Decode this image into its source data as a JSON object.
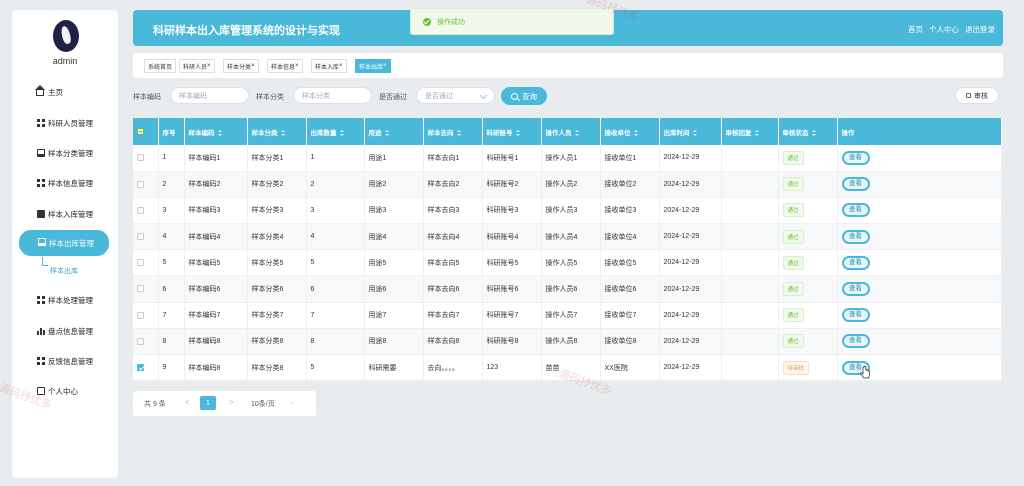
{
  "app": {
    "title": "科研样本出入库管理系统的设计与实现",
    "user": "admin"
  },
  "header_links": [
    "首页",
    "个人中心",
    "退出登录"
  ],
  "toast": "操作成功",
  "sidebar": {
    "items": [
      {
        "label": "主页",
        "icon": "home-icon"
      },
      {
        "label": "科研人员管理",
        "icon": "grid-icon"
      },
      {
        "label": "样本分类管理",
        "icon": "monitor-icon"
      },
      {
        "label": "样本信息管理",
        "icon": "grid-icon"
      },
      {
        "label": "样本入库管理",
        "icon": "film-icon"
      },
      {
        "label": "样本出库管理",
        "icon": "monitor-icon"
      },
      {
        "label": "样本处理管理",
        "icon": "grid-icon"
      },
      {
        "label": "盘点信息管理",
        "icon": "bar-chart-icon"
      },
      {
        "label": "反馈信息管理",
        "icon": "grid-icon"
      },
      {
        "label": "个人中心",
        "icon": "user-card-icon"
      }
    ],
    "active": "样本出库管理",
    "sub_item": "样本出库"
  },
  "tabs": [
    "系统首页",
    "科研人员",
    "样本分类",
    "样本信息",
    "样本入库",
    "样本出库"
  ],
  "tab_close": "×",
  "search": {
    "code_label": "样本编码",
    "code_placeholder": "样本编码",
    "category_label": "样本分类",
    "category_placeholder": "样本分类",
    "pass_label": "是否通过",
    "pass_placeholder": "是否通过",
    "query_label": "查询",
    "audit_label": "审核"
  },
  "table": {
    "columns": [
      "序号",
      "样本编码",
      "样本分类",
      "出库数量",
      "用途",
      "样本去向",
      "科研账号",
      "操作人员",
      "接收单位",
      "出库时间",
      "审核回复",
      "审核状态",
      "操作"
    ],
    "rows": [
      {
        "idx": "1",
        "code": "样本编码1",
        "cat": "样本分类1",
        "qty": "1",
        "use": "用途1",
        "dest": "样本去向1",
        "acct": "科研账号1",
        "op": "操作人员1",
        "recv": "接收单位1",
        "time": "2024-12-29",
        "reply": "",
        "status": "通过",
        "status_type": "pass",
        "action": "查看",
        "checked": false
      },
      {
        "idx": "2",
        "code": "样本编码2",
        "cat": "样本分类2",
        "qty": "2",
        "use": "用途2",
        "dest": "样本去向2",
        "acct": "科研账号2",
        "op": "操作人员2",
        "recv": "接收单位2",
        "time": "2024-12-29",
        "reply": "",
        "status": "通过",
        "status_type": "pass",
        "action": "查看",
        "checked": false
      },
      {
        "idx": "3",
        "code": "样本编码3",
        "cat": "样本分类3",
        "qty": "3",
        "use": "用途3",
        "dest": "样本去向3",
        "acct": "科研账号3",
        "op": "操作人员3",
        "recv": "接收单位3",
        "time": "2024-12-29",
        "reply": "",
        "status": "通过",
        "status_type": "pass",
        "action": "查看",
        "checked": false
      },
      {
        "idx": "4",
        "code": "样本编码4",
        "cat": "样本分类4",
        "qty": "4",
        "use": "用途4",
        "dest": "样本去向4",
        "acct": "科研账号4",
        "op": "操作人员4",
        "recv": "接收单位4",
        "time": "2024-12-29",
        "reply": "",
        "status": "通过",
        "status_type": "pass",
        "action": "查看",
        "checked": false
      },
      {
        "idx": "5",
        "code": "样本编码5",
        "cat": "样本分类5",
        "qty": "5",
        "use": "用途5",
        "dest": "样本去向5",
        "acct": "科研账号5",
        "op": "操作人员5",
        "recv": "接收单位5",
        "time": "2024-12-29",
        "reply": "",
        "status": "通过",
        "status_type": "pass",
        "action": "查看",
        "checked": false
      },
      {
        "idx": "6",
        "code": "样本编码6",
        "cat": "样本分类6",
        "qty": "6",
        "use": "用途6",
        "dest": "样本去向6",
        "acct": "科研账号6",
        "op": "操作人员6",
        "recv": "接收单位6",
        "time": "2024-12-29",
        "reply": "",
        "status": "通过",
        "status_type": "pass",
        "action": "查看",
        "checked": false
      },
      {
        "idx": "7",
        "code": "样本编码7",
        "cat": "样本分类7",
        "qty": "7",
        "use": "用途7",
        "dest": "样本去向7",
        "acct": "科研账号7",
        "op": "操作人员7",
        "recv": "接收单位7",
        "time": "2024-12-29",
        "reply": "",
        "status": "通过",
        "status_type": "pass",
        "action": "查看",
        "checked": false
      },
      {
        "idx": "8",
        "code": "样本编码8",
        "cat": "样本分类8",
        "qty": "8",
        "use": "用途8",
        "dest": "样本去向8",
        "acct": "科研账号8",
        "op": "操作人员8",
        "recv": "接收单位8",
        "time": "2024-12-29",
        "reply": "",
        "status": "通过",
        "status_type": "pass",
        "action": "查看",
        "checked": false
      },
      {
        "idx": "9",
        "code": "样本编码8",
        "cat": "样本分类8",
        "qty": "5",
        "use": "科研需要",
        "dest": "去向。。。。",
        "acct": "123",
        "op": "苗苗",
        "recv": "XX医院",
        "time": "2024-12-29",
        "reply": "",
        "status": "待审核",
        "status_type": "pending",
        "action": "查看",
        "checked": true
      }
    ]
  },
  "pager": {
    "total": "共 9 条",
    "prev": "<",
    "current": "1",
    "next": ">",
    "page_size": "10条/页",
    "size_arrow": "⌄"
  },
  "watermarks": [
    "源码抒优多",
    "源码抒优多",
    "源码抒优多"
  ],
  "colors": {
    "primary": "#4ab8d9",
    "success": "#67c23a",
    "warning": "#e6a23c"
  }
}
